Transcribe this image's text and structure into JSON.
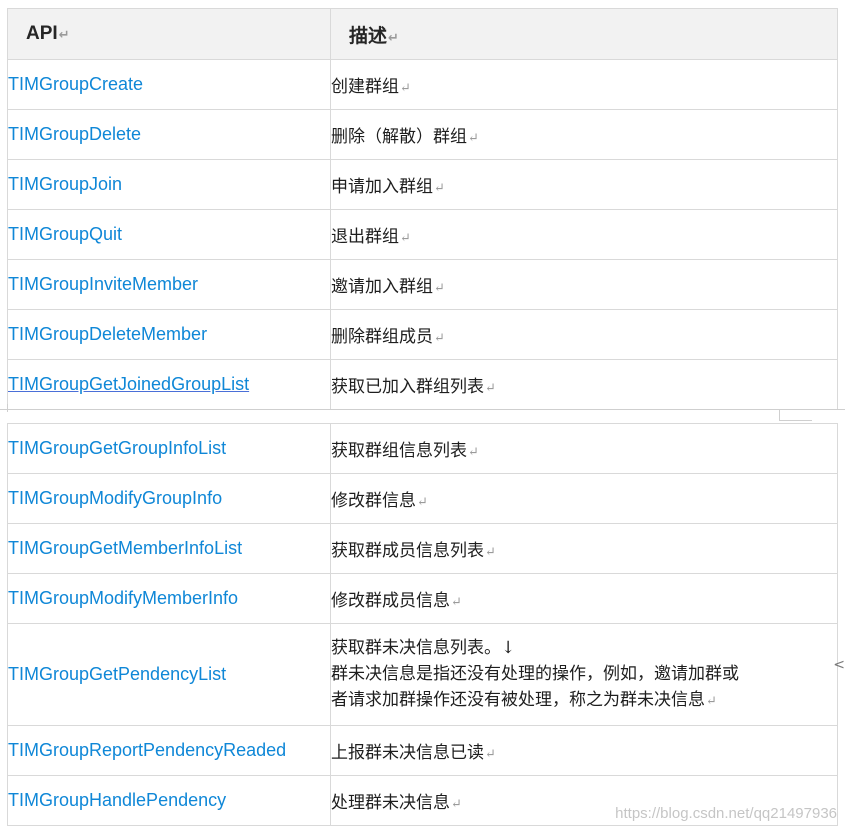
{
  "table": {
    "header": {
      "api": "API",
      "desc": "描述",
      "return_mark": "↵"
    },
    "rows_top": [
      {
        "api": "TIMGroupCreate",
        "desc": "创建群组"
      },
      {
        "api": "TIMGroupDelete",
        "desc": "删除（解散）群组"
      },
      {
        "api": "TIMGroupJoin",
        "desc": "申请加入群组"
      },
      {
        "api": "TIMGroupQuit",
        "desc": "退出群组"
      },
      {
        "api": "TIMGroupInviteMember",
        "desc": "邀请加入群组"
      },
      {
        "api": "TIMGroupDeleteMember",
        "desc": "删除群组成员"
      },
      {
        "api": "TIMGroupGetJoinedGroupList",
        "desc": "获取已加入群组列表"
      }
    ],
    "rows_bottom": [
      {
        "api": "TIMGroupGetGroupInfoList",
        "desc": "获取群组信息列表"
      },
      {
        "api": "TIMGroupModifyGroupInfo",
        "desc": "修改群信息"
      },
      {
        "api": "TIMGroupGetMemberInfoList",
        "desc": "获取群成员信息列表"
      },
      {
        "api": "TIMGroupModifyMemberInfo",
        "desc": "修改群成员信息"
      },
      {
        "api": "TIMGroupGetPendencyList",
        "desc_line1": "获取群未决信息列表。↓",
        "desc_line2": "群未决信息是指还没有处理的操作，例如，邀请加群或",
        "desc_line3": "者请求加群操作还没有被处理，称之为群未决信息"
      },
      {
        "api": "TIMGroupReportPendencyReaded",
        "desc": "上报群未决信息已读"
      },
      {
        "api": "TIMGroupHandlePendency",
        "desc": "处理群未决信息"
      }
    ]
  },
  "watermark": "https://blog.csdn.net/qq21497936",
  "edge_mark": "<",
  "colors": {
    "link": "#0f87d7",
    "header_bg": "#f2f2f2",
    "border": "#d9d9d9"
  }
}
